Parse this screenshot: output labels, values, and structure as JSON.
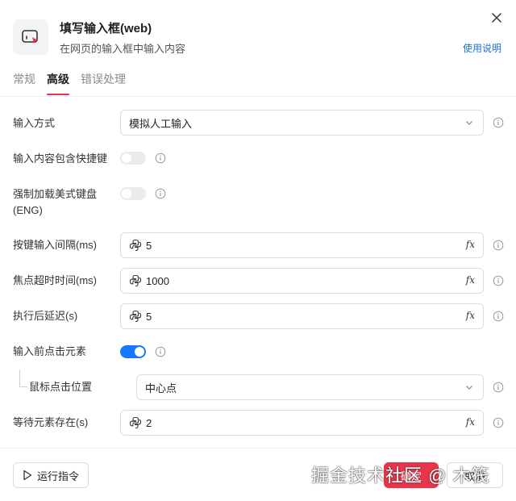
{
  "header": {
    "title": "填写输入框(web)",
    "subtitle": "在网页的输入框中输入内容",
    "help_link": "使用说明"
  },
  "tabs": [
    {
      "label": "常规",
      "active": false
    },
    {
      "label": "高级",
      "active": true
    },
    {
      "label": "错误处理",
      "active": false
    }
  ],
  "form": {
    "input_method": {
      "label": "输入方式",
      "value": "模拟人工输入"
    },
    "include_shortcuts": {
      "label": "输入内容包含快捷键",
      "enabled": false
    },
    "force_us_keyboard": {
      "label_line1": "强制加载美式键盘",
      "label_line2": "(ENG)",
      "enabled": false
    },
    "key_interval": {
      "label": "按键输入间隔(ms)",
      "value": "5"
    },
    "focus_timeout": {
      "label": "焦点超时时间(ms)",
      "value": "1000"
    },
    "post_delay": {
      "label": "执行后延迟(s)",
      "value": "5"
    },
    "click_before_input": {
      "label": "输入前点击元素",
      "enabled": true
    },
    "mouse_click_position": {
      "label": "鼠标点击位置",
      "value": "中心点"
    },
    "wait_element": {
      "label": "等待元素存在(s)",
      "value": "2"
    }
  },
  "footer": {
    "run_label": "运行指令",
    "confirm_label": "确定",
    "cancel_label": "取消",
    "watermark": "掘金技术社区 @ 木筏"
  },
  "colors": {
    "accent": "#e8354b",
    "link": "#1f6fd1",
    "toggle_on": "#1677ff",
    "toggle_off": "#ebebeb"
  },
  "icons": {
    "app": "browser-input-icon",
    "close": "close-icon",
    "info": "info-icon",
    "expression": "fx-icon",
    "python": "python-icon",
    "dropdown": "chevron-down-icon",
    "run": "play-icon"
  }
}
